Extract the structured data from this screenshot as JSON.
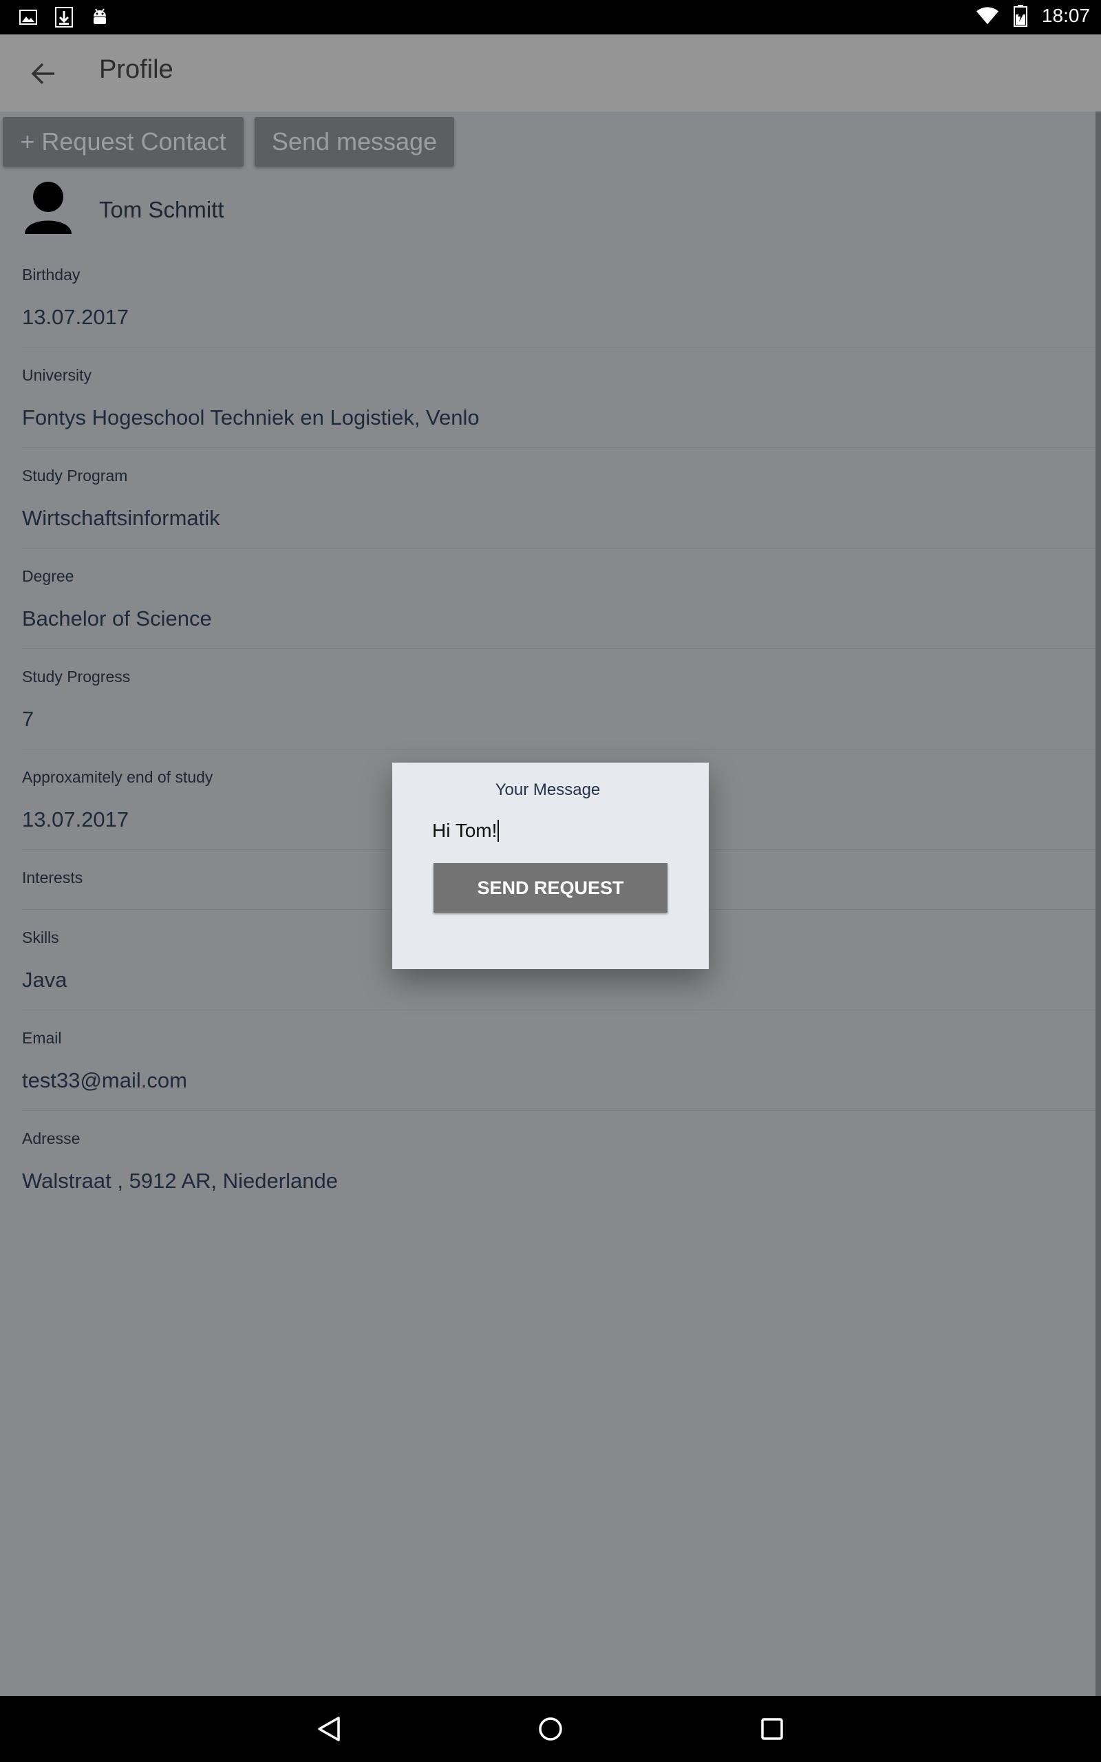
{
  "status_bar": {
    "time": "18:07",
    "left_icons": [
      "image-icon",
      "download-icon",
      "android-icon"
    ],
    "right_icons": [
      "wifi-icon",
      "battery-icon"
    ]
  },
  "app_bar": {
    "title": "Profile",
    "back_icon": "arrow-back-icon"
  },
  "actions": {
    "request_contact": "+ Request Contact",
    "send_message": "Send message"
  },
  "profile": {
    "name": "Tom Schmitt",
    "fields": [
      {
        "label": "Birthday",
        "value": "13.07.2017"
      },
      {
        "label": "University",
        "value": "Fontys Hogeschool Techniek en Logistiek, Venlo"
      },
      {
        "label": "Study Program",
        "value": "Wirtschaftsinformatik"
      },
      {
        "label": "Degree",
        "value": "Bachelor of Science"
      },
      {
        "label": "Study Progress",
        "value": "7"
      },
      {
        "label": "Approxamitely end of study",
        "value": "13.07.2017"
      },
      {
        "label": "Interests",
        "value": ""
      },
      {
        "label": "Skills",
        "value": "Java"
      },
      {
        "label": "Email",
        "value": "test33@mail.com"
      },
      {
        "label": "Adresse",
        "value": "Walstraat , 5912 AR, Niederlande"
      }
    ]
  },
  "dialog": {
    "title": "Your Message",
    "input_value": "Hi Tom!",
    "button_label": "SEND REQUEST"
  },
  "colors": {
    "background_overlay": "#87898c",
    "dialog_bg": "#e6e9ed",
    "dialog_button": "#737373",
    "text_dark": "#1e2533"
  },
  "nav_bar": {
    "icons": [
      "back-triangle-icon",
      "home-circle-icon",
      "recents-square-icon"
    ]
  }
}
